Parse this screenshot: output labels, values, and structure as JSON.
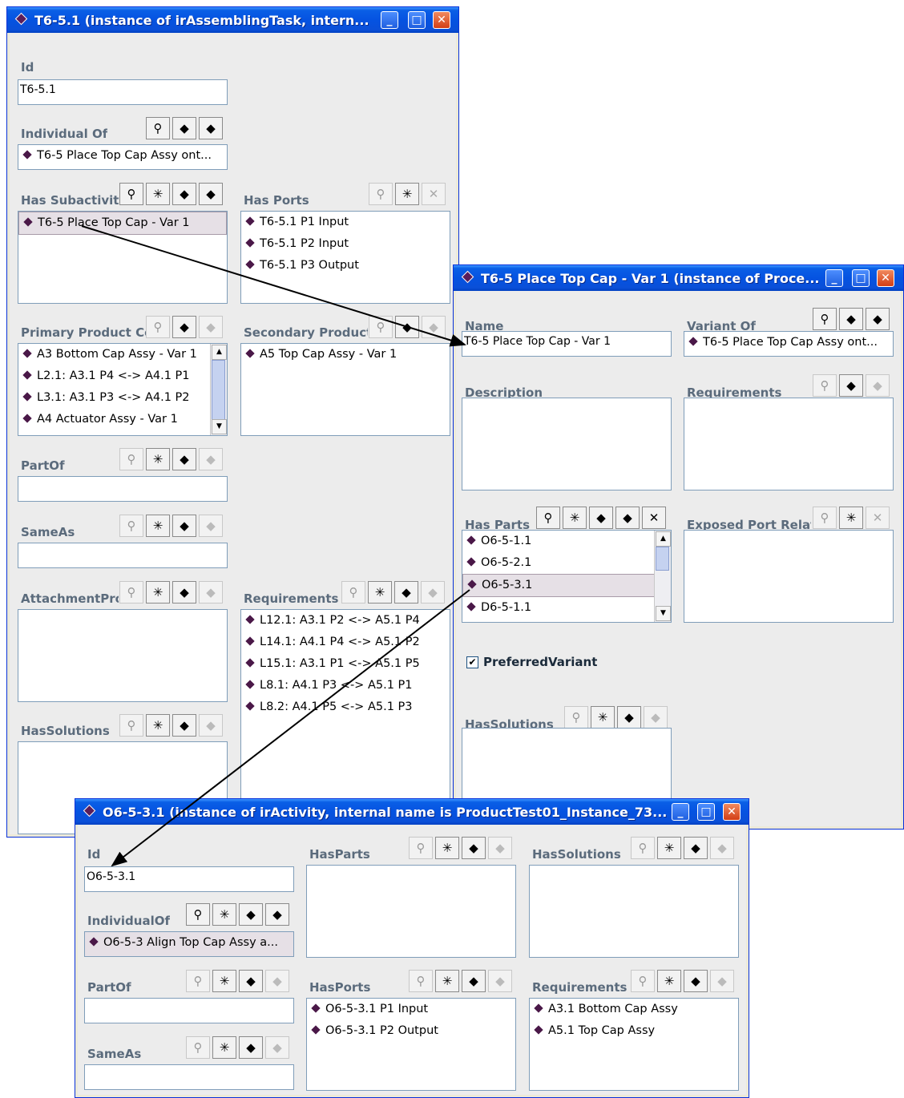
{
  "win1": {
    "title": "T6-5.1   (instance of irAssemblingTask, intern...",
    "id_label": "Id",
    "id_value": "T6-5.1",
    "individual_of_label": "Individual Of",
    "individual_of_value": "T6-5 Place Top Cap Assy ont...",
    "has_subactivities_label": "Has Subactiviti",
    "has_subactivities_items": [
      "T6-5 Place Top Cap - Var 1"
    ],
    "has_ports_label": "Has Ports",
    "has_ports_items": [
      "T6-5.1 P1 Input",
      "T6-5.1 P2 Input",
      "T6-5.1 P3 Output"
    ],
    "primary_label": "Primary Product Co",
    "primary_items": [
      "A3 Bottom Cap Assy - Var 1",
      "L2.1: A3.1 P4 <-> A4.1 P1",
      "L3.1: A3.1 P3 <-> A4.1 P2",
      "A4 Actuator Assy - Var 1"
    ],
    "secondary_label": "Secondary Product",
    "secondary_items": [
      "A5 Top Cap Assy - Var 1"
    ],
    "partof_label": "PartOf",
    "sameas_label": "SameAs",
    "attachment_label": "AttachmentPro",
    "requirements_label": "Requirements",
    "requirements_items": [
      "L12.1: A3.1 P2 <-> A5.1 P4",
      "L14.1: A4.1 P4 <-> A5.1 P2",
      "L15.1: A3.1 P1 <-> A5.1 P5",
      "L8.1: A4.1 P3 <-> A5.1 P1",
      "L8.2: A4.1 P5 <-> A5.1 P3"
    ],
    "hassolutions_label": "HasSolutions"
  },
  "win2": {
    "title": "T6-5 Place Top Cap - Var 1    (instance of Proce...",
    "name_label": "Name",
    "name_value": "T6-5 Place Top Cap - Var 1",
    "variant_of_label": "Variant Of",
    "variant_of_value": "T6-5 Place Top Cap Assy ont...",
    "description_label": "Description",
    "requirements_label": "Requirements",
    "has_parts_label": "Has Parts",
    "has_parts_items": [
      "O6-5-1.1",
      "O6-5-2.1",
      "O6-5-3.1",
      "D6-5-1.1"
    ],
    "exposed_label": "Exposed Port Relati",
    "preferred_label": "PreferredVariant",
    "hassolutions_label": "HasSolutions"
  },
  "win3": {
    "title": "O6-5-3.1   (instance of irActivity, internal name is ProductTest01_Instance_73...",
    "id_label": "Id",
    "id_value": "O6-5-3.1",
    "individual_of_label": "IndividualOf",
    "individual_of_value": "O6-5-3 Align Top Cap Assy a...",
    "partof_label": "PartOf",
    "sameas_label": "SameAs",
    "hasparts_label": "HasParts",
    "hasports_label": "HasPorts",
    "hasports_items": [
      "O6-5-3.1 P1 Input",
      "O6-5-3.1 P2 Output"
    ],
    "hassolutions_label": "HasSolutions",
    "requirements_label": "Requirements",
    "requirements_items": [
      "A3.1 Bottom Cap Assy",
      "A5.1 Top Cap Assy"
    ]
  }
}
